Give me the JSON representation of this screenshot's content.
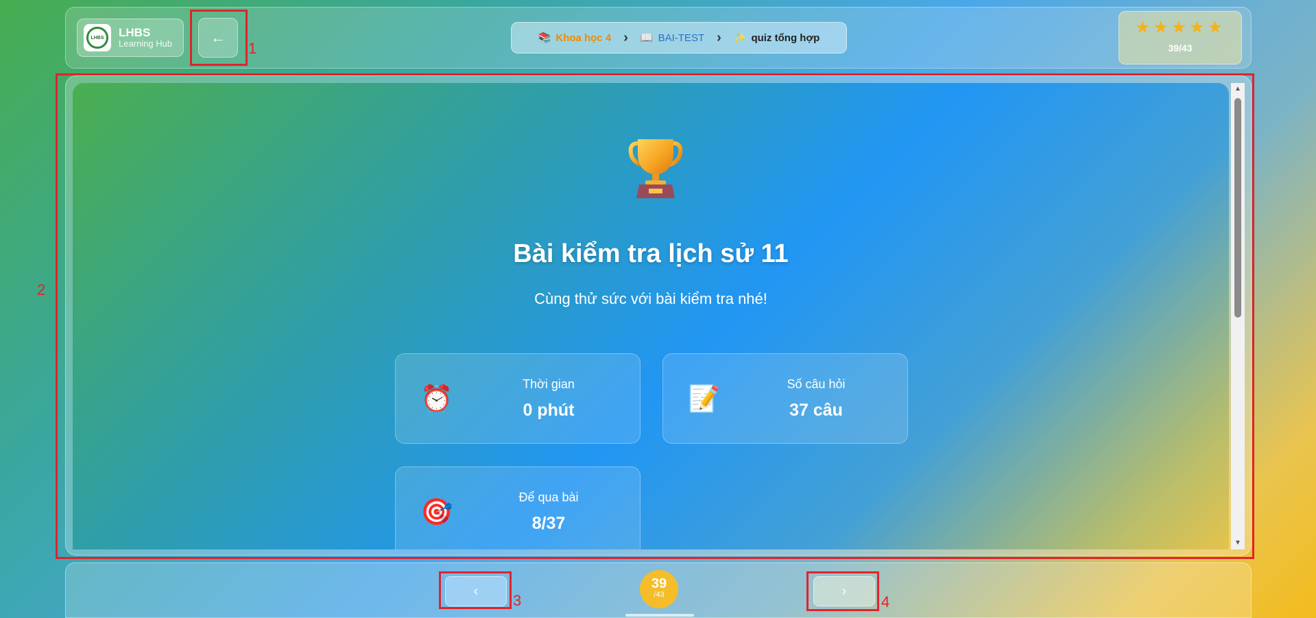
{
  "header": {
    "logo_title": "LHBS",
    "logo_subtitle": "Learning Hub",
    "logo_badge_text": "LHBS",
    "back_icon": "←",
    "breadcrumb": [
      {
        "icon": "📚",
        "label": "Khoa học 4"
      },
      {
        "icon": "📖",
        "label": "BAI-TEST"
      },
      {
        "icon": "✨",
        "label": "quiz tổng hợp"
      }
    ],
    "breadcrumb_separator": "›",
    "stars": "★★★★★",
    "progress": "39/43"
  },
  "quiz": {
    "title": "Bài kiểm tra lịch sử 11",
    "subtitle": "Cùng thử sức với bài kiểm tra nhé!",
    "stats": [
      {
        "icon": "⏰",
        "label": "Thời gian",
        "value": "0 phút"
      },
      {
        "icon": "📝",
        "label": "Số câu hỏi",
        "value": "37 câu"
      },
      {
        "icon": "🎯",
        "label": "Để qua bài",
        "value": "8/37"
      }
    ]
  },
  "footer": {
    "prev_icon": "‹",
    "next_icon": "›",
    "page_current": "39",
    "page_total": "/43"
  },
  "annotations": [
    "1",
    "2",
    "3",
    "4"
  ],
  "colors": {
    "annotation": "#e0232b",
    "breadcrumb_course": "#f08a00",
    "breadcrumb_lesson": "#2d6fc9",
    "page_badge": "#f5bd2a",
    "stars": "#f5b21c"
  }
}
